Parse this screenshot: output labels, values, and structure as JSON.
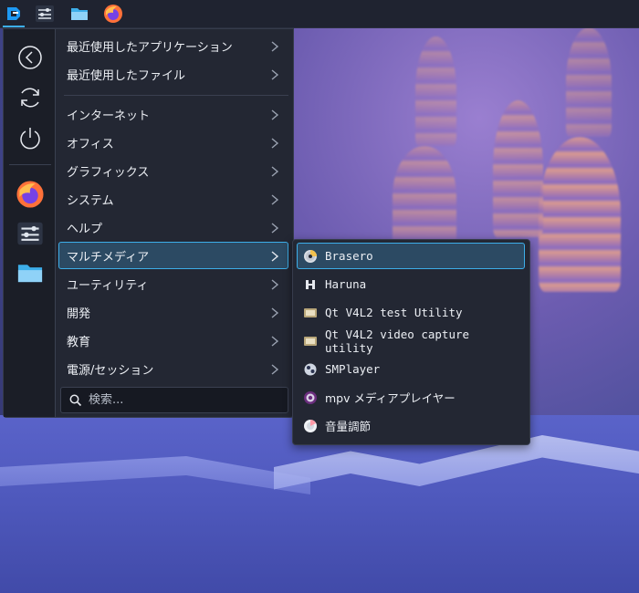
{
  "taskbar": {
    "items": [
      {
        "name": "app-launcher",
        "icon": "kde-launcher-icon"
      },
      {
        "name": "system-settings",
        "icon": "sliders-icon"
      },
      {
        "name": "file-manager",
        "icon": "folder-icon"
      },
      {
        "name": "firefox",
        "icon": "firefox-icon"
      }
    ]
  },
  "favorites": {
    "actions": [
      {
        "icon": "back-icon"
      },
      {
        "icon": "refresh-icon"
      },
      {
        "icon": "power-icon"
      }
    ],
    "apps": [
      {
        "icon": "firefox-icon"
      },
      {
        "icon": "sliders-icon"
      },
      {
        "icon": "folder-icon"
      }
    ]
  },
  "menu": {
    "categories": [
      {
        "label": "最近使用したアプリケーション"
      },
      {
        "label": "最近使用したファイル"
      },
      {
        "label": "インターネット"
      },
      {
        "label": "オフィス"
      },
      {
        "label": "グラフィックス"
      },
      {
        "label": "システム"
      },
      {
        "label": "ヘルプ"
      },
      {
        "label": "マルチメディア"
      },
      {
        "label": "ユーティリティ"
      },
      {
        "label": "開発"
      },
      {
        "label": "教育"
      },
      {
        "label": "電源/セッション"
      }
    ],
    "selected": "マルチメディア"
  },
  "search": {
    "placeholder": "検索...",
    "value": ""
  },
  "submenu": {
    "items": [
      {
        "label": "Brasero",
        "icon": "disc-icon"
      },
      {
        "label": "Haruna",
        "icon": "haruna-icon"
      },
      {
        "label": "Qt V4L2 test Utility",
        "icon": "webcam-icon"
      },
      {
        "label": "Qt V4L2 video capture utility",
        "icon": "webcam-icon"
      },
      {
        "label": "SMPlayer",
        "icon": "smplayer-icon"
      },
      {
        "label": "mpv メディアプレイヤー",
        "icon": "mpv-icon"
      },
      {
        "label": "音量調節",
        "icon": "volume-icon"
      }
    ],
    "highlighted": "Brasero"
  },
  "colors": {
    "accent": "#3daee9",
    "menu_bg": "#232733",
    "highlight_bg": "#2c4a63",
    "taskbar_bg": "#1f2330"
  }
}
